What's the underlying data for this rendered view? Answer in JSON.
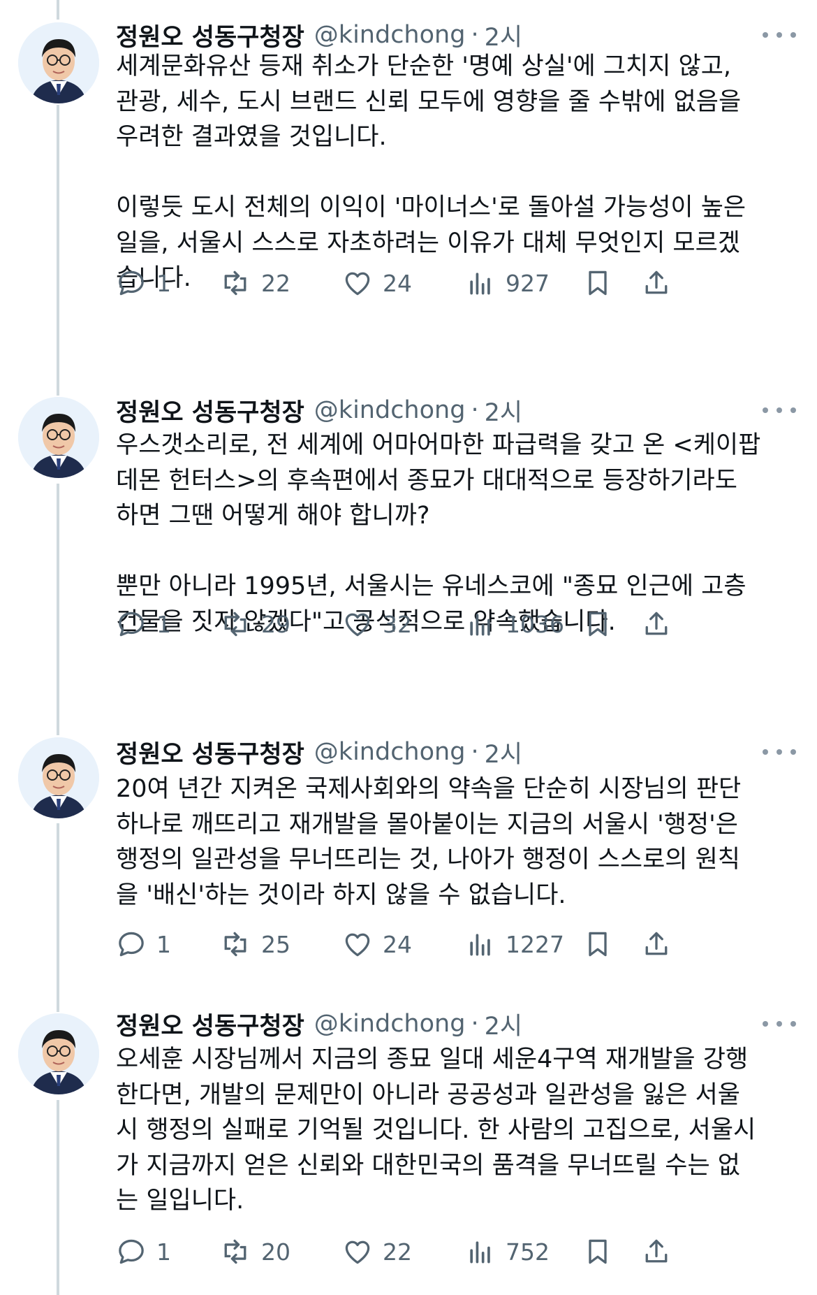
{
  "tweets": [
    {
      "name": "정원오 성동구청장",
      "handle": "@kindchong",
      "time": "2시",
      "text": "세계문화유산 등재 취소가 단순한 '명예 상실'에 그치지 않고,\n관광, 세수, 도시 브랜드 신뢰 모두에 영향을 줄 수밖에 없음을\n우려한 결과였을 것입니다.\n\n이렇듯 도시 전체의 이익이 '마이너스'로 돌아설 가능성이 높은\n일을, 서울시 스스로 자초하려는 이유가 대체 무엇인지 모르겠\n습니다.",
      "replies": "1",
      "retweets": "22",
      "likes": "24",
      "views": "927"
    },
    {
      "name": "정원오 성동구청장",
      "handle": "@kindchong",
      "time": "2시",
      "text": "우스갯소리로, 전 세계에 어마어마한 파급력을 갖고 온 <케이팝\n데몬 헌터스>의 후속편에서 종묘가 대대적으로 등장하기라도\n하면 그땐 어떻게 해야 합니까?\n\n뿐만 아니라 1995년, 서울시는 유네스코에 \"종묘 인근에 고층\n건물을 짓지 않겠다\"고 공식적으로 약속했습니다.",
      "replies": "1",
      "retweets": "29",
      "likes": "32",
      "views": "1036"
    },
    {
      "name": "정원오 성동구청장",
      "handle": "@kindchong",
      "time": "2시",
      "text": "20여 년간 지켜온 국제사회와의 약속을 단순히 시장님의 판단\n하나로 깨뜨리고 재개발을 몰아붙이는 지금의 서울시 '행정'은\n행정의 일관성을 무너뜨리는 것, 나아가 행정이 스스로의 원칙\n을 '배신'하는 것이라 하지 않을 수 없습니다.",
      "replies": "1",
      "retweets": "25",
      "likes": "24",
      "views": "1227"
    },
    {
      "name": "정원오 성동구청장",
      "handle": "@kindchong",
      "time": "2시",
      "text": "오세훈 시장님께서 지금의 종묘 일대 세운4구역 재개발을 강행\n한다면, 개발의 문제만이 아니라 공공성과 일관성을 잃은 서울\n시 행정의 실패로 기억될 것입니다. 한 사람의 고집으로, 서울시\n가 지금까지 얻은 신뢰와 대한민국의 품격을 무너뜨릴 수는 없\n는 일입니다.",
      "replies": "1",
      "retweets": "20",
      "likes": "22",
      "views": "752"
    }
  ],
  "icons": {
    "reply": "reply-icon",
    "retweet": "retweet-icon",
    "like": "heart-icon",
    "views": "views-icon",
    "bookmark": "bookmark-icon",
    "share": "share-icon",
    "more": "more-icon"
  },
  "colors": {
    "text": "#0f1419",
    "secondary": "#536471",
    "thread_line": "#cfd9de"
  }
}
